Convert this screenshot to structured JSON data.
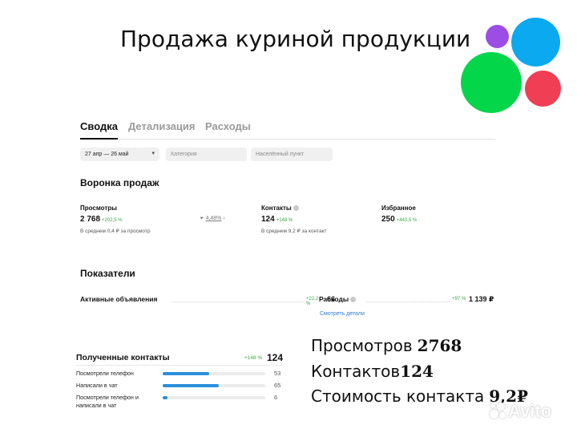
{
  "slide": {
    "title": "Продажа куриной продукции"
  },
  "tabs": [
    {
      "label": "Сводка"
    },
    {
      "label": "Детализация"
    },
    {
      "label": "Расходы"
    }
  ],
  "filters": {
    "date_range": "27 апр — 26 май",
    "category_placeholder": "Категория",
    "location_placeholder": "Населённый пункт"
  },
  "funnel": {
    "title": "Воронка продаж",
    "views": {
      "label": "Просмотры",
      "value": "2 768",
      "delta": "+202,5 %",
      "average": "В среднем 0,4 ₽ за просмотр"
    },
    "conversion": {
      "value": "4,48%"
    },
    "contacts": {
      "label": "Контакты",
      "value": "124",
      "delta": "+148 %",
      "average": "В среднем 9,2 ₽ за контакт"
    },
    "favorites": {
      "label": "Избранное",
      "value": "250",
      "delta": "+443,5 %"
    }
  },
  "metrics": {
    "title": "Показатели",
    "active_ads": {
      "label": "Активные объявления",
      "delta": "+22,2 %",
      "value": "66"
    },
    "expenses": {
      "label": "Расходы",
      "delta": "+97 %",
      "value": "1 139 ₽",
      "details_link": "Смотреть детали"
    }
  },
  "received_contacts": {
    "title": "Полученные контакты",
    "delta": "+148 %",
    "total": "124",
    "rows": [
      {
        "label": "Посмотрели телефон",
        "value": "53",
        "share": 0.45
      },
      {
        "label": "Написали в чат",
        "value": "65",
        "share": 0.55
      },
      {
        "label": "Посмотрели телефон и написали в чат",
        "value": "6",
        "share": 0.05
      }
    ]
  },
  "summary": {
    "views_label": "Просмотров",
    "views_value": "2768",
    "contacts_label": "Контактов",
    "contacts_value": "124",
    "cost_label": "Стоимость контакта",
    "cost_value": "9,2₽"
  },
  "watermark": {
    "text": "Avito"
  },
  "colors": {
    "accent_blue": "#2b8fdc",
    "positive_green": "#3aa644",
    "logo_purple": "#9b4de6",
    "logo_blue": "#0aa9f0",
    "logo_green": "#04d64a",
    "logo_red": "#f03e55"
  }
}
